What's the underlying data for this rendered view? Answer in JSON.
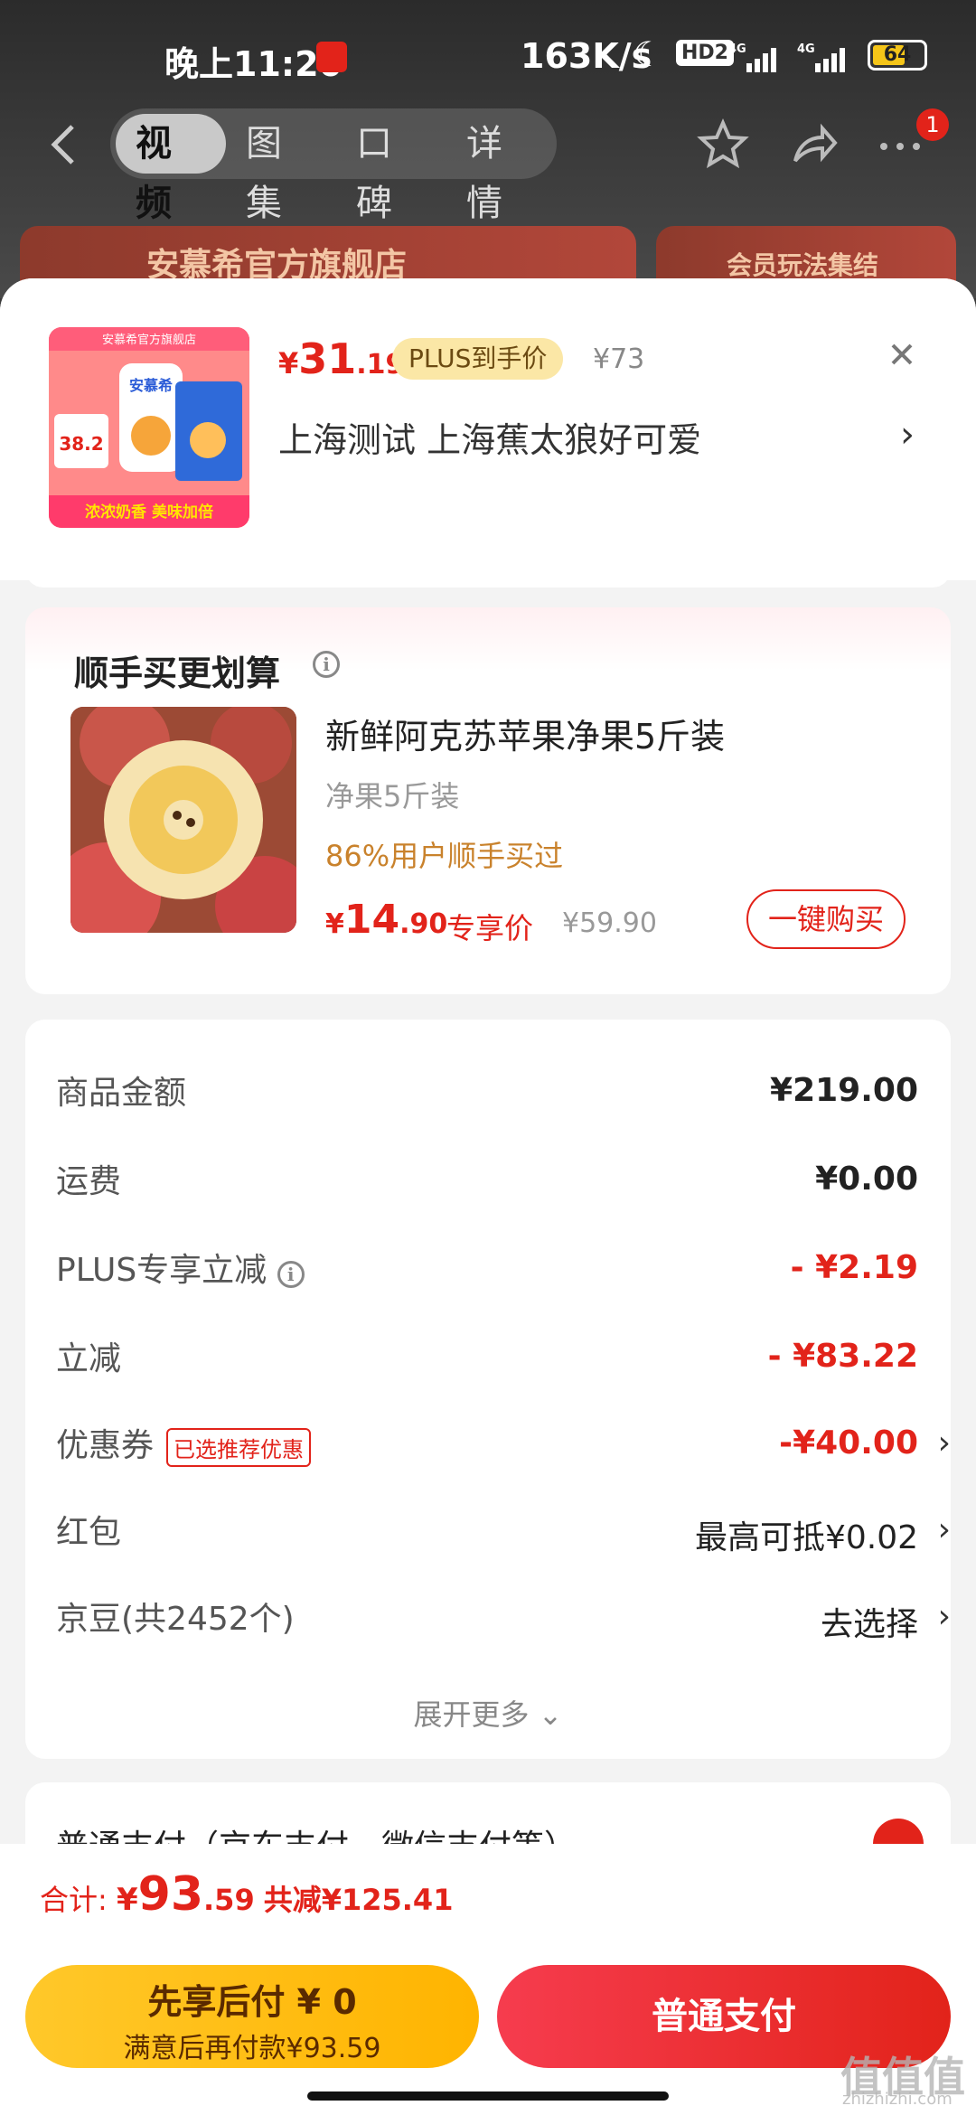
{
  "status": {
    "time": "晚上11:20",
    "speed": "163K/s",
    "hd": "HD2",
    "net1": "4G",
    "net2": "4G",
    "battery": "64",
    "battery_level": 0.64
  },
  "nav": {
    "tabs": [
      {
        "label": "视频",
        "active": true
      },
      {
        "label": "图集",
        "active": false
      },
      {
        "label": "口碑",
        "active": false
      },
      {
        "label": "详情",
        "active": false
      }
    ],
    "badge": "1"
  },
  "banners": {
    "left": "安慕希官方旗舰店",
    "right": "会员玩法集结"
  },
  "product": {
    "price_symbol": "¥",
    "price_int": "31",
    "price_dec": ".19",
    "plus_tag": "PLUS到手价",
    "orig_price": "¥73",
    "address": "上海测试  上海蕉太狼好可爱",
    "thumb_shop": "安慕希官方旗舰店",
    "thumb_brand": "安慕希",
    "thumb_price": "38.2",
    "thumb_slogan": "浓浓奶香 美味加倍"
  },
  "upsell": {
    "title": "顺手买更划算",
    "name": "新鲜阿克苏苹果净果5斤装",
    "sub": "净果5斤装",
    "social": "86%用户顺手买过",
    "price_symbol": "¥",
    "price_int": "14",
    "price_dec": ".90",
    "price_label": "专享价",
    "orig": "¥59.90",
    "buy_label": "一键购买"
  },
  "cost": {
    "rows": [
      {
        "label": "商品金额",
        "value": "¥219.00"
      },
      {
        "label": "运费",
        "value": "¥0.00"
      },
      {
        "label": "PLUS专享立减",
        "value": "- ¥2.19"
      },
      {
        "label": "立减",
        "value": "- ¥83.22"
      },
      {
        "label": "优惠券",
        "tag": "已选推荐优惠",
        "value": "-¥40.00"
      },
      {
        "label": "红包",
        "value": "最高可抵¥0.02"
      },
      {
        "label": "京豆(共2452个)",
        "value": "去选择"
      }
    ],
    "expand": "展开更多 ⌄"
  },
  "payment": {
    "title": "普通支付（京东支付、微信支付等）"
  },
  "bottom": {
    "total_label": "合计: ",
    "total_symbol": "¥",
    "total_int": "93",
    "total_dec": ".59",
    "save": "共减¥125.41",
    "bnpl_line1": "先享后付 ¥ 0",
    "bnpl_line2": "满意后再付款¥93.59",
    "normal_label": "普通支付"
  },
  "watermark": {
    "main": "值值值",
    "sub": "zhizhizhi.com"
  },
  "colors": {
    "accent": "#e2231a",
    "gold": "#ffc82a"
  }
}
